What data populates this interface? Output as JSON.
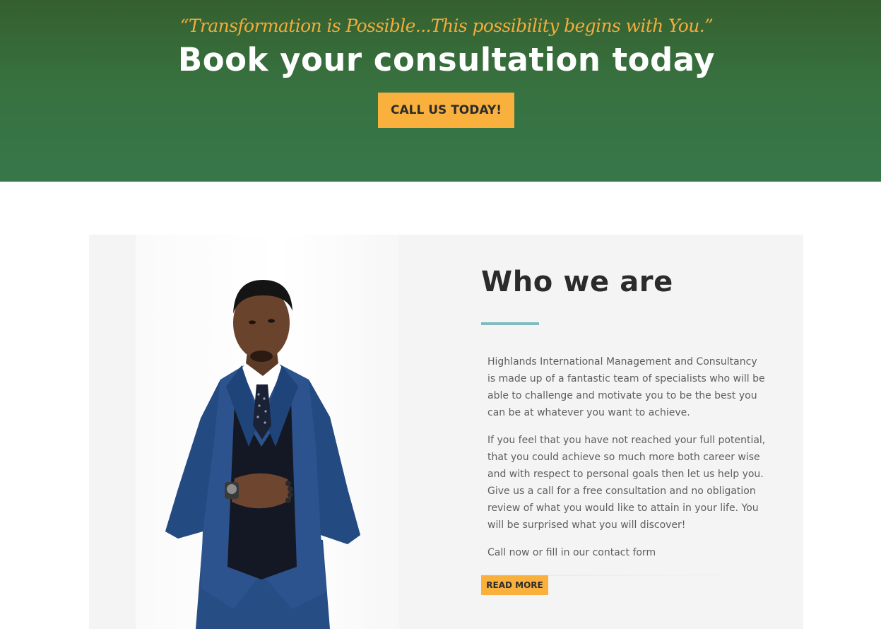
{
  "hero": {
    "quote": "“Transformation is Possible...This possibility begins with You.”",
    "title": "Book your consultation today",
    "cta_label": "CALL US TODAY!"
  },
  "about": {
    "image_alt": "Man in blue suit",
    "title": "Who we are",
    "paragraphs": [
      "Highlands International Management and Consultancy is made up of a fantastic team of specialists who will be able to challenge and motivate you to be the best you can be at whatever you want to achieve.",
      "If you feel that you have not reached your full potential, that you could achieve so much more both career wise and with respect to personal goals then let us help you. Give us a call for a free consultation and no obligation review of what you would like to attain in your life. You will be surprised what you will discover!",
      "Call now or fill in our contact form"
    ],
    "button_label": "READ MORE"
  },
  "colors": {
    "hero_green": "#37713f",
    "accent_orange": "#f9b03c",
    "rule_teal": "#7fbcc0",
    "panel_grey": "#f4f4f4"
  }
}
